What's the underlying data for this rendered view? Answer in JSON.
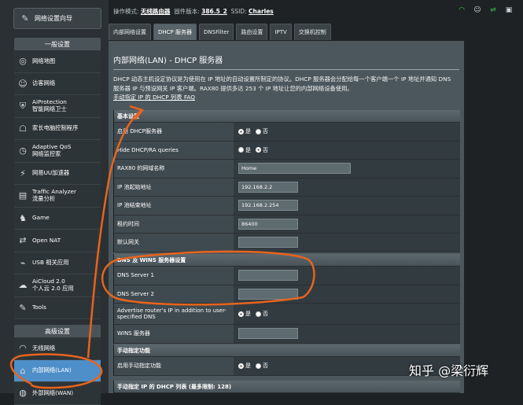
{
  "sidebar": {
    "quick": "网络设置向导",
    "general_header": "一般设置",
    "general_items": [
      {
        "label": "网络地图",
        "icon": "network-map-icon"
      },
      {
        "label": "访客网络",
        "icon": "guest-network-icon"
      },
      {
        "label": "AiProtection\n智能网络卫士",
        "icon": "shield-icon"
      },
      {
        "label": "家长电脑控制程序",
        "icon": "parental-control-icon"
      },
      {
        "label": "Adaptive QoS\n网络监控家",
        "icon": "qos-icon"
      },
      {
        "label": "网易UU加速器",
        "icon": "uu-accelerator-icon"
      },
      {
        "label": "Traffic Analyzer\n流量分析",
        "icon": "traffic-analyzer-icon"
      },
      {
        "label": "Game",
        "icon": "game-icon"
      },
      {
        "label": "Open NAT",
        "icon": "open-nat-icon"
      },
      {
        "label": "USB 相关应用",
        "icon": "usb-icon"
      },
      {
        "label": "AiCloud 2.0\n个人云 2.0 应用",
        "icon": "cloud-icon"
      },
      {
        "label": "Tools",
        "icon": "tools-icon"
      }
    ],
    "advanced_header": "高级设置",
    "advanced_items": [
      {
        "label": "无线网络",
        "icon": "wireless-icon"
      },
      {
        "label": "内部网络(LAN)",
        "icon": "lan-icon"
      },
      {
        "label": "外部网络(WAN)",
        "icon": "wan-icon"
      }
    ]
  },
  "topbar": {
    "mode_label": "操作模式:",
    "mode_value": "无线路由器",
    "fw_label": "固件版本:",
    "fw_value": "386.5_2",
    "ssid_label": "SSID:",
    "ssid_value": "Charles"
  },
  "tabs": [
    "内部网络设置",
    "DHCP 服务器",
    "DNSFilter",
    "路由设置",
    "IPTV",
    "交换机控制"
  ],
  "active_tab": 1,
  "page": {
    "title": "内部网络(LAN) - DHCP 服务器",
    "desc1": "DHCP 动态主机设定协议是为使用在 IP 地址的自动设置所制定的协议。DHCP 服务器会分配给每一个客户端一个 IP 地址并通知 DNS 服务器 IP 与预设网关 IP 客户端。RAX80 提供多达 253 个 IP 地址让您的内部网络设备使用。",
    "faq_link": "手动指定 IP 的 DHCP 列表 FAQ"
  },
  "basic": {
    "header": "基本设置",
    "rows": [
      {
        "label": "启用 DHCP服务器",
        "type": "radio",
        "yes": "是",
        "no": "否",
        "selected": "yes"
      },
      {
        "label": "Hide DHCP/RA queries",
        "type": "radio",
        "yes": "是",
        "no": "否",
        "selected": "no"
      },
      {
        "label": "RAX80 的网域名称",
        "type": "input",
        "value": "Home",
        "width": "wide"
      },
      {
        "label": "IP 池起始地址",
        "type": "input",
        "value": "192.168.2.2"
      },
      {
        "label": "IP 池结束地址",
        "type": "input",
        "value": "192.168.2.254"
      },
      {
        "label": "租约时间",
        "type": "input",
        "value": "86400"
      },
      {
        "label": "默认网关",
        "type": "input",
        "value": ""
      }
    ]
  },
  "dns": {
    "header": "DNS 及 WINS 服务器设置",
    "rows": [
      {
        "label": "DNS Server 1",
        "type": "input",
        "value": ""
      },
      {
        "label": "DNS Server 2",
        "type": "input",
        "value": ""
      },
      {
        "label": "Advertise router's IP in addition to user-specified DNS",
        "type": "radio",
        "yes": "是",
        "no": "否",
        "selected": "yes"
      },
      {
        "label": "WINS 服务器",
        "type": "input",
        "value": ""
      }
    ]
  },
  "manual": {
    "header": "手动指定功能",
    "rows": [
      {
        "label": "启用手动指定功能",
        "type": "radio",
        "yes": "是",
        "no": "否",
        "selected": "yes"
      }
    ]
  },
  "list_header": "手动指定 IP 的 DHCP 列表 (最多限制: 128)",
  "watermark": "知乎 @梁衍辉",
  "colors": {
    "annotation": "#e8641c",
    "active_nav": "#4f8fc9",
    "panel": "#4b575c"
  }
}
